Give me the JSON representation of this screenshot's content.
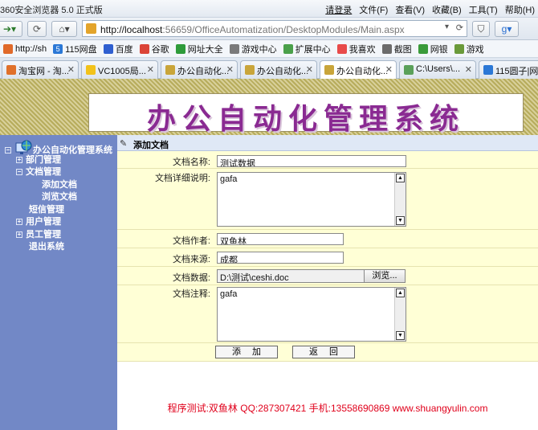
{
  "browser": {
    "title": "360安全浏览器 5.0 正式版",
    "login": "请登录",
    "menus": [
      "文件(F)",
      "查看(V)",
      "收藏(B)",
      "工具(T)",
      "帮助(H)"
    ],
    "address": {
      "host": "http://localhost",
      "rest": ":56659/OfficeAutomatization/DesktopModules/Main.aspx"
    },
    "favorites": [
      "http://sh",
      "115网盘",
      "百度",
      "谷歌",
      "网址大全",
      "游戏中心",
      "扩展中心",
      "我喜欢",
      "截图",
      "网银",
      "游戏"
    ],
    "tabs": [
      "淘宝网 - 淘...",
      "VC1005局...",
      "办公自动化...",
      "办公自动化...",
      "办公自动化...",
      "C:\\Users\\...",
      "115圆子|网..."
    ]
  },
  "banner": {
    "title": "办公自动化管理系统"
  },
  "sidebar": {
    "root": "办公自动化管理系统",
    "items": [
      {
        "label": "部门管理",
        "marker": "+"
      },
      {
        "label": "文档管理",
        "marker": "-"
      },
      {
        "label": "添加文档",
        "marker": ""
      },
      {
        "label": "浏览文档",
        "marker": ""
      },
      {
        "label": "短信管理",
        "marker": ""
      },
      {
        "label": "用户管理",
        "marker": "+"
      },
      {
        "label": "员工管理",
        "marker": "+"
      },
      {
        "label": "退出系统",
        "marker": ""
      }
    ]
  },
  "panel": {
    "heading": "添加文档",
    "fields": {
      "name_label": "文档名称:",
      "name_value": "测试数据",
      "detail_label": "文档详细说明:",
      "detail_value": "gafa",
      "author_label": "文档作者:",
      "author_value": "双鱼林",
      "source_label": "文档来源:",
      "source_value": "成都",
      "file_label": "文档数据:",
      "file_value": "D:\\测试\\ceshi.doc",
      "browse_label": "浏览...",
      "note_label": "文档注释:",
      "note_value": "gafa"
    },
    "add_button": "添加",
    "back_button": "返回"
  },
  "footer": "程序测试:双鱼林 QQ:287307421 手机:13558690869 www.shuangyulin.com"
}
